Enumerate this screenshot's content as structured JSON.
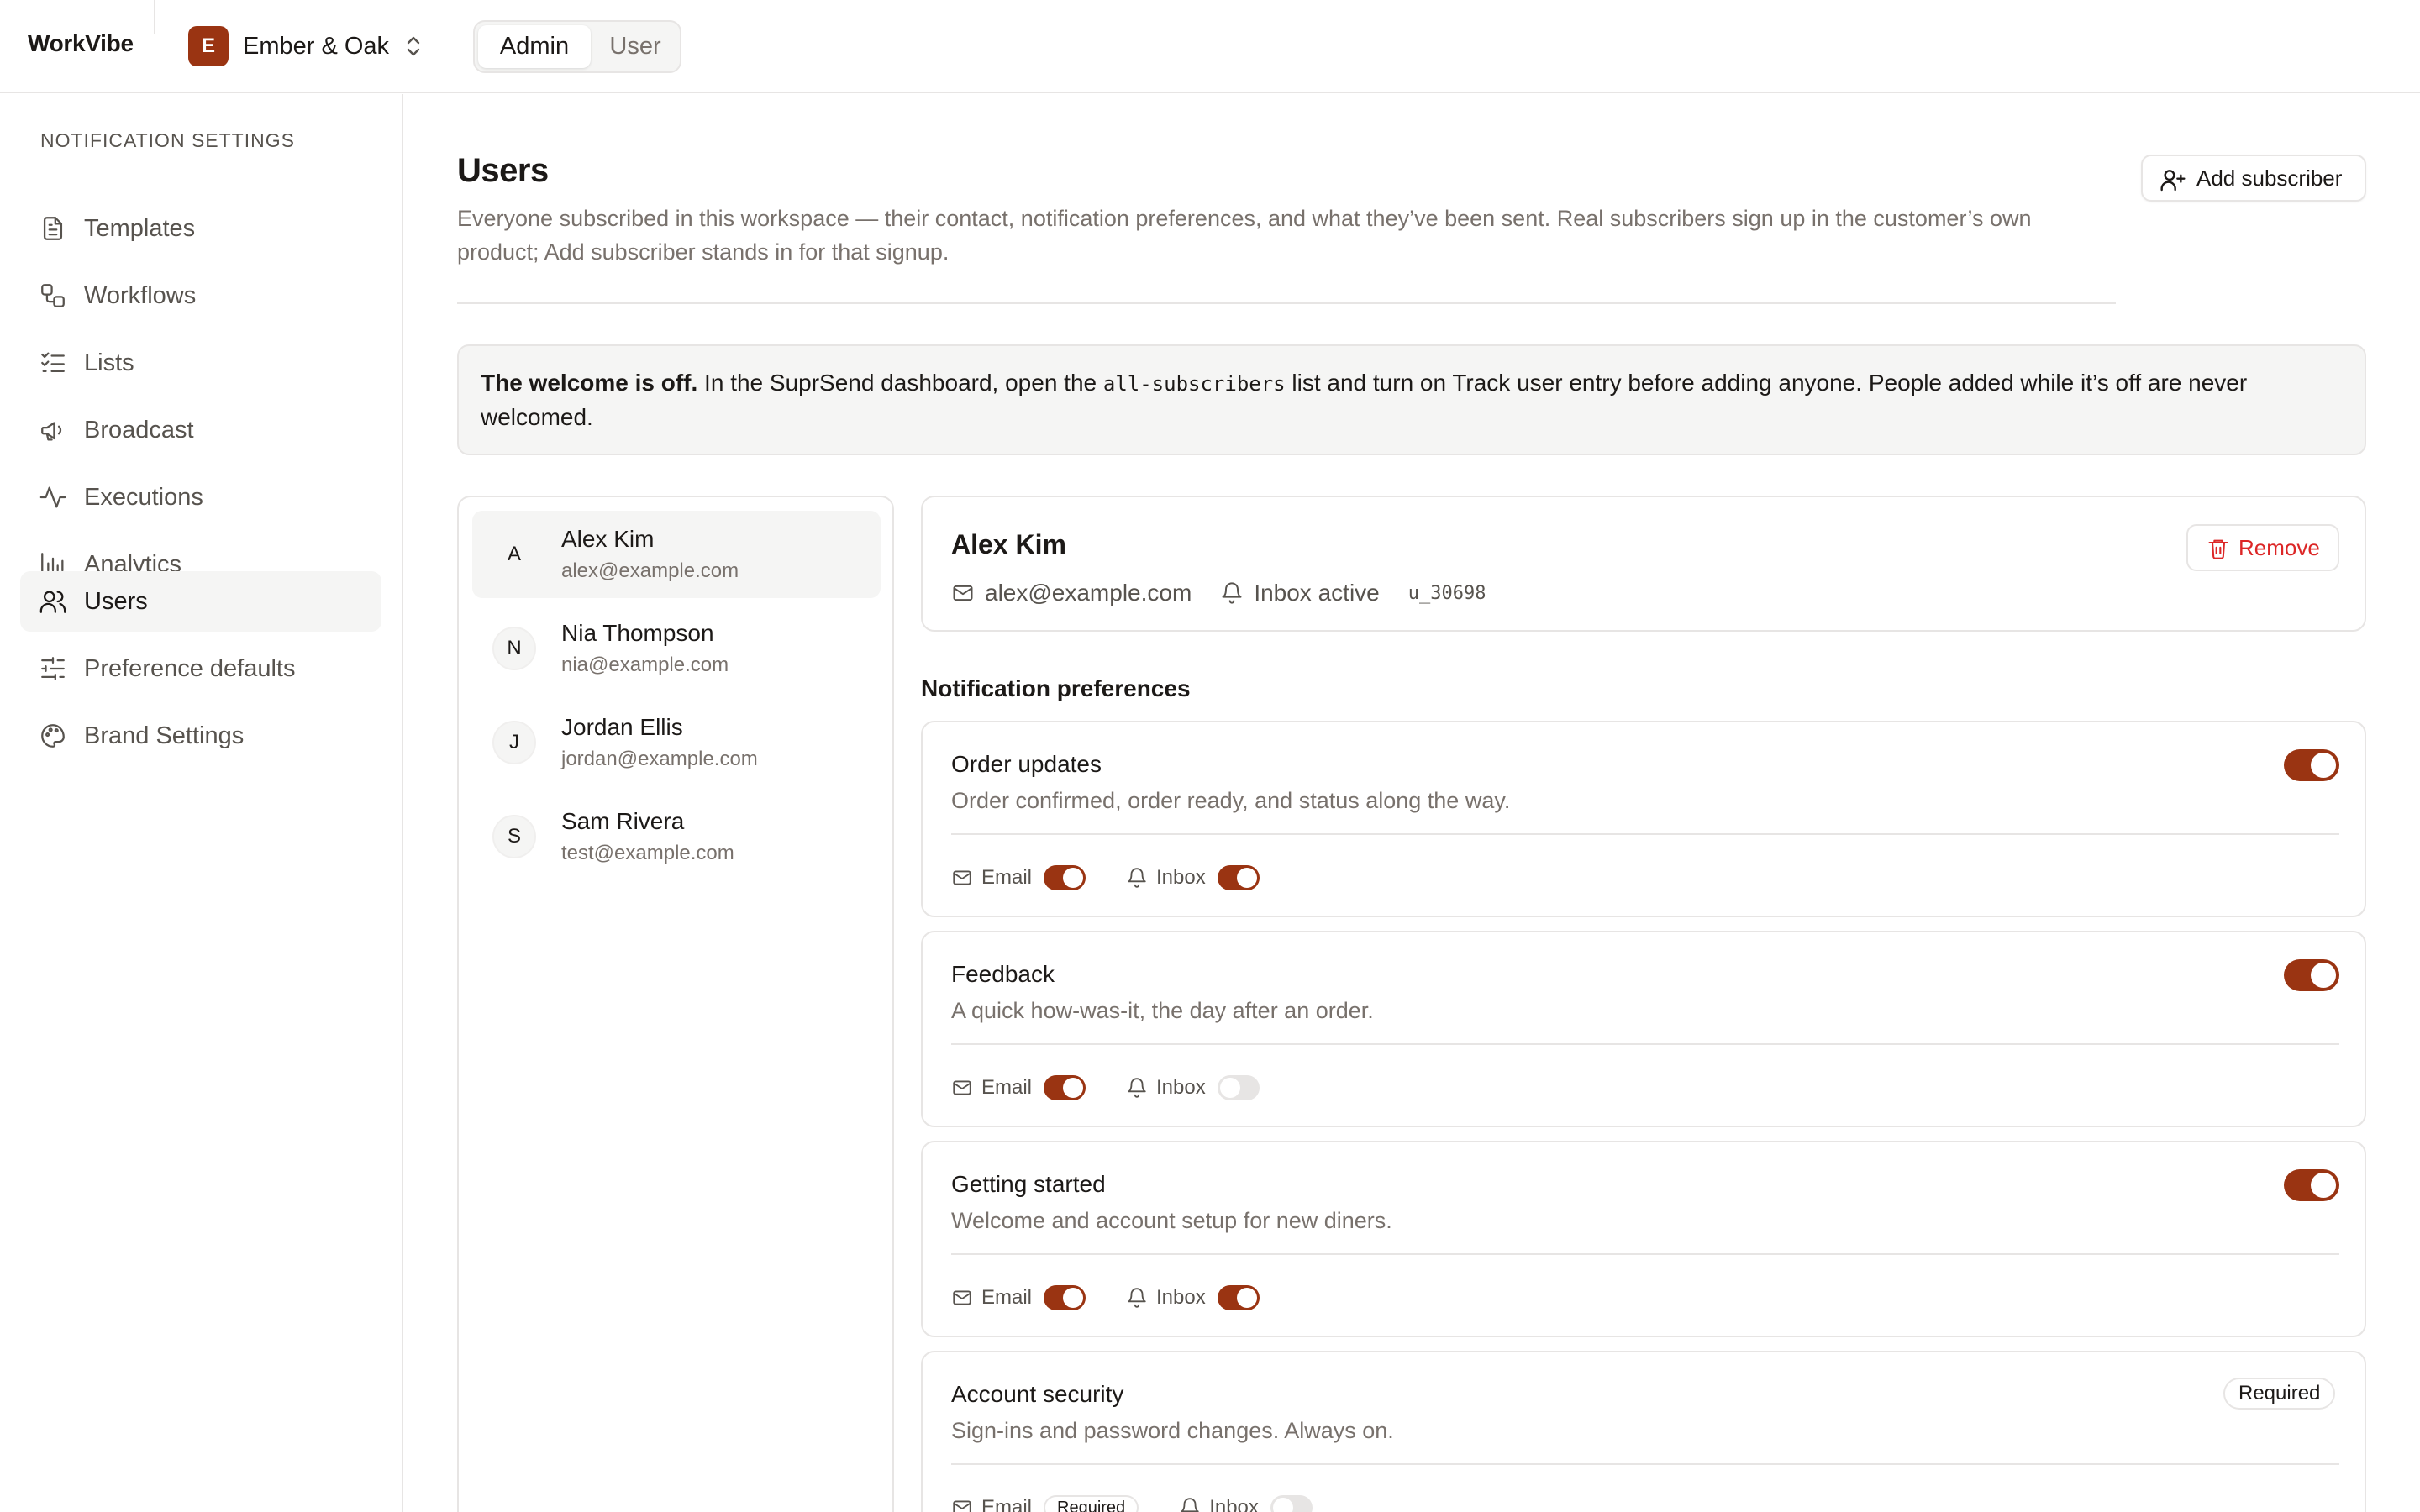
{
  "app": {
    "name": "WorkVibe"
  },
  "workspace": {
    "initial": "E",
    "name": "Ember & Oak"
  },
  "role_switch": {
    "options": [
      "Admin",
      "User"
    ],
    "selected": "Admin"
  },
  "sidebar": {
    "heading": "NOTIFICATION SETTINGS",
    "items": [
      {
        "label": "Templates",
        "icon": "file-text-icon"
      },
      {
        "label": "Workflows",
        "icon": "workflow-icon"
      },
      {
        "label": "Lists",
        "icon": "list-checks-icon"
      },
      {
        "label": "Broadcast",
        "icon": "megaphone-icon"
      },
      {
        "label": "Executions",
        "icon": "activity-icon"
      },
      {
        "label": "Analytics",
        "icon": "bar-chart-icon"
      },
      {
        "label": "Users",
        "icon": "users-icon",
        "active": true
      },
      {
        "label": "Preference defaults",
        "icon": "sliders-icon"
      },
      {
        "label": "Brand Settings",
        "icon": "palette-icon"
      }
    ]
  },
  "header": {
    "title": "Users",
    "description": "Everyone subscribed in this workspace — their contact, notification preferences, and what they’ve been sent. Real subscribers sign up in the customer’s own product; Add subscriber stands in for that signup.",
    "add_button": "Add subscriber"
  },
  "banner": {
    "bold": "The welcome is off.",
    "text_before": " In the SuprSend dashboard, open the ",
    "code": "all-subscribers",
    "text_after": " list and turn on Track user entry before adding anyone. People added while it’s off are never welcomed."
  },
  "users": [
    {
      "initial": "A",
      "name": "Alex Kim",
      "email": "alex@example.com",
      "selected": true
    },
    {
      "initial": "N",
      "name": "Nia Thompson",
      "email": "nia@example.com"
    },
    {
      "initial": "J",
      "name": "Jordan Ellis",
      "email": "jordan@example.com"
    },
    {
      "initial": "S",
      "name": "Sam Rivera",
      "email": "test@example.com"
    }
  ],
  "detail": {
    "name": "Alex Kim",
    "email": "alex@example.com",
    "inbox_status": "Inbox active",
    "user_id": "u_30698",
    "remove_label": "Remove"
  },
  "preferences": {
    "title": "Notification preferences",
    "categories": [
      {
        "title": "Order updates",
        "description": "Order confirmed, order ready, and status along the way.",
        "enabled": true,
        "channels": {
          "email": true,
          "inbox": true
        }
      },
      {
        "title": "Feedback",
        "description": "A quick how-was-it, the day after an order.",
        "enabled": true,
        "channels": {
          "email": true,
          "inbox": false
        }
      },
      {
        "title": "Getting started",
        "description": "Welcome and account setup for new diners.",
        "enabled": true,
        "channels": {
          "email": true,
          "inbox": true
        }
      },
      {
        "title": "Account security",
        "description": "Sign-ins and password changes. Always on.",
        "badge": "Required",
        "channels": {
          "email_badge": "Required",
          "inbox": false
        }
      }
    ],
    "channel_labels": {
      "email": "Email",
      "inbox": "Inbox"
    }
  },
  "colors": {
    "accent": "#9a3412",
    "danger": "#dc2626",
    "muted": "#78716c",
    "border": "#e7e5e4"
  }
}
